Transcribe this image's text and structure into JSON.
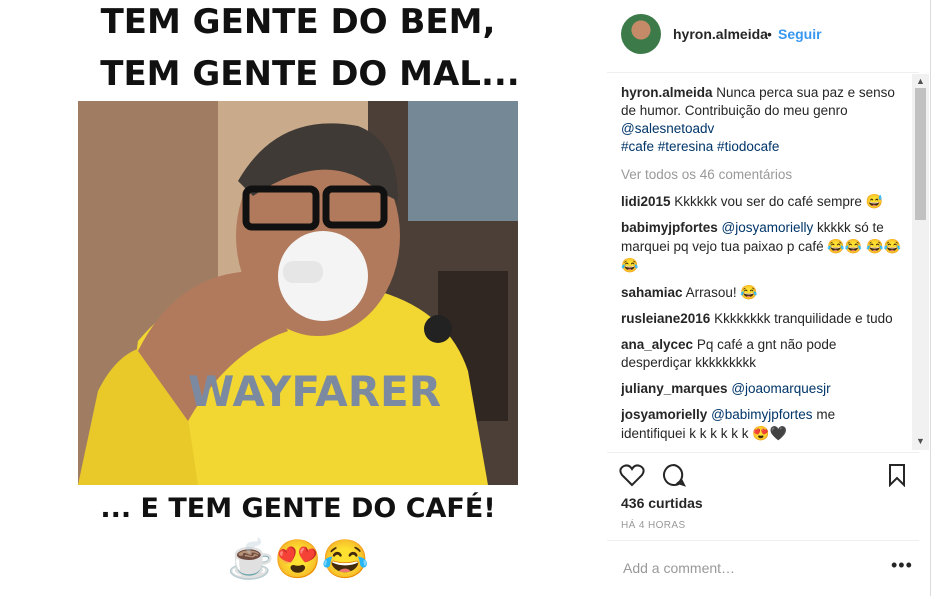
{
  "meme": {
    "line1": "TEM GENTE DO BEM,",
    "line2": "TEM GENTE DO MAL...",
    "line3": "... E TEM GENTE DO CAFÉ!",
    "emojis": "☕😍😂"
  },
  "photo": {
    "shirt_text": "WAYFARER"
  },
  "header": {
    "username": "hyron.almeida",
    "separator": "•",
    "follow_label": "Seguir"
  },
  "caption": {
    "username": "hyron.almeida",
    "text": "Nunca perca sua paz e senso de humor. Contribuição do meu genro",
    "mention": "@salesnetoadv",
    "hashtags": "#cafe #teresina #tiodocafe"
  },
  "view_all": "Ver todos os 46 comentários",
  "comments": [
    {
      "user": "lidi2015",
      "text": "Kkkkkk vou ser do café sempre",
      "mention": "",
      "emoji": "😅"
    },
    {
      "user": "babimyjpfortes",
      "mention": "@josyamorielly",
      "text": "kkkkk só te marquei pq vejo tua paixao p café",
      "emoji": "😂😂 😂😂😂"
    },
    {
      "user": "sahamiac",
      "text": "Arrasou!",
      "mention": "",
      "emoji": "😂"
    },
    {
      "user": "rusleiane2016",
      "text": "Kkkkkkkk tranquilidade e tudo",
      "mention": "",
      "emoji": ""
    },
    {
      "user": "ana_alycec",
      "text": "Pq café a gnt não pode desperdiçar kkkkkkkkk",
      "mention": "",
      "emoji": ""
    },
    {
      "user": "juliany_marques",
      "mention": "@joaomarquesjr",
      "text": "",
      "emoji": ""
    },
    {
      "user": "josyamorielly",
      "mention": "@babimyjpfortes",
      "text": "me identifiquei k k k k k k",
      "emoji": "😍🖤"
    }
  ],
  "likes": "436 curtidas",
  "time": "HÁ 4 HORAS",
  "add_comment": {
    "placeholder": "Add a comment…"
  },
  "more_options": "•••",
  "icons": {
    "like": "heart-icon",
    "comment": "comment-icon",
    "save": "bookmark-icon"
  }
}
